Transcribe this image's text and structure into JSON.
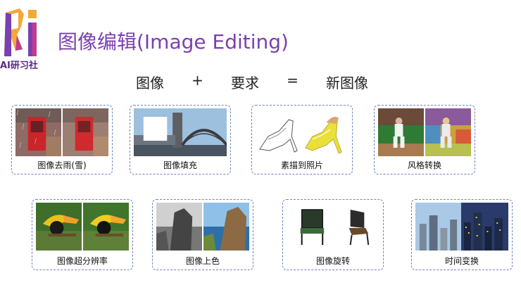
{
  "logo": {
    "text": "AI研习社",
    "icon": "ri-logo"
  },
  "title": "图像编辑(Image Editing)",
  "equation": {
    "left": "图像",
    "plus": "+",
    "middle": "要求",
    "equals": "=",
    "right": "新图像"
  },
  "cards": [
    {
      "label": "图像去雨(雪)"
    },
    {
      "label": "图像填充"
    },
    {
      "label": "素描到照片"
    },
    {
      "label": "风格转换"
    },
    {
      "label": "图像超分辨率"
    },
    {
      "label": "图像上色"
    },
    {
      "label": "图像旋转"
    },
    {
      "label": "时间变换"
    }
  ]
}
